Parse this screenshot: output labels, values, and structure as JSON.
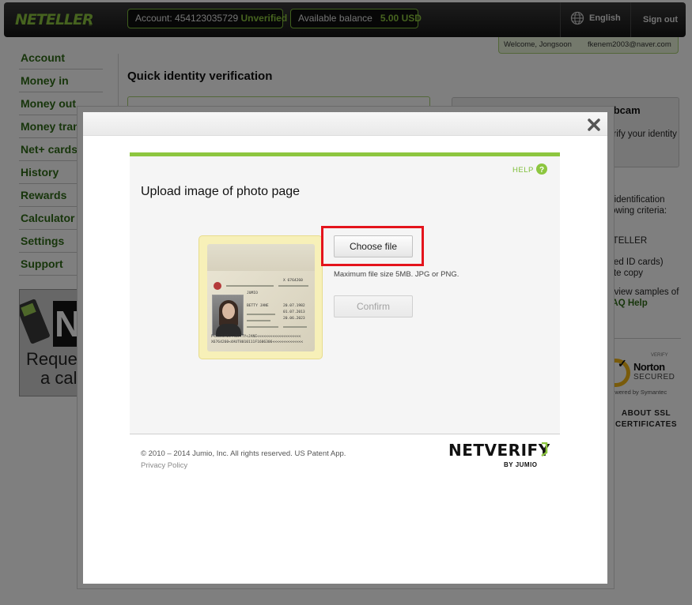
{
  "header": {
    "logo": "NETELLER",
    "logo_reg": "®",
    "account_label": "Account: ",
    "account_number": "454123035729",
    "account_status": "Unverified",
    "balance_label": "Available balance",
    "balance_value": "5.00 USD",
    "language": "English",
    "signout": "Sign out",
    "welcome": "Welcome, Jongsoon",
    "email": "fkenem2003@naver.com"
  },
  "nav": {
    "items": [
      {
        "label": "Account"
      },
      {
        "label": "Money in"
      },
      {
        "label": "Money out"
      },
      {
        "label": "Money transfer"
      },
      {
        "label": "Net+ cards"
      },
      {
        "label": "History"
      },
      {
        "label": "Rewards"
      },
      {
        "label": "Calculator"
      },
      {
        "label": "Settings"
      },
      {
        "label": "Support"
      }
    ]
  },
  "request_call": {
    "n_letter": "N",
    "line1": "Reque",
    "line2": "a cal"
  },
  "page": {
    "title": "Quick identity verification"
  },
  "webcam_panel": {
    "title": "Verification via webcam",
    "text": "erify your identity"
  },
  "side": {
    "line1": "d identification",
    "line2": "llowing criteria:",
    "line3": "ETELLER",
    "line4": "iired ID cards)",
    "line5": "hite copy",
    "line6": "d view samples of",
    "line7": "FAQ Help"
  },
  "norton": {
    "verify": "VERIFY",
    "check": "✓",
    "name": "Norton",
    "secured": "SECURED",
    "powered": "powered by Symantec"
  },
  "ssl": {
    "line1": "ABOUT SSL",
    "line2": "CERTIFICATES"
  },
  "modal": {
    "help": "HELP",
    "upload_title": "Upload image of photo page",
    "choose_file": "Choose file",
    "file_hint": "Maximum file size 5MB. JPG or PNG.",
    "confirm": "Confirm",
    "copyright": "© 2010 – 2014 Jumio, Inc. All rights reserved. US Patent App.",
    "privacy": "Privacy Policy",
    "brand": "NETVERIFY",
    "brand_by": "BY JUMIO",
    "passport": {
      "surname": "JUMIO",
      "given": "BETTY JANE",
      "doc_no": "X 6764260",
      "dob": "20.07.1982",
      "issued": "01.07.2013",
      "expires": "20.06.2023",
      "mrz1": "P<ROJUMIO<<BETTY<JANE<<<<<<<<<<<<<<<<<<<<",
      "mrz2": "X6764260<4AUT8010111F1606306<<<<<<<<<<<<<<"
    }
  },
  "colors": {
    "brand_green": "#8dc63f",
    "nav_green": "#2f6b16",
    "highlight_red": "#e4141c"
  }
}
